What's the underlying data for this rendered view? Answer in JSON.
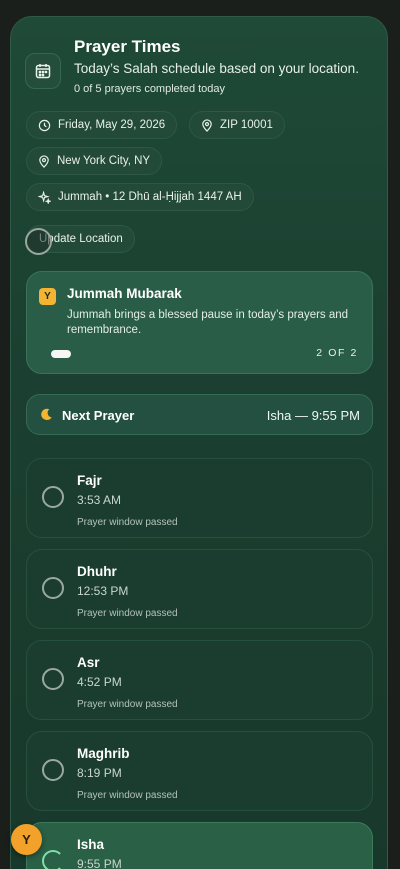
{
  "header": {
    "title": "Prayer Times",
    "subtitle": "Today’s Salah schedule based on your location.",
    "progress": "0 of 5 prayers completed today"
  },
  "chips": {
    "date": "Friday, May 29, 2026",
    "zip": "ZIP 10001",
    "city": "New York City, NY",
    "hijri": "Jummah • 12 Dhū al-Ḥijjah 1447 AH"
  },
  "update_button": "Update Location",
  "banner": {
    "badge": "Y",
    "title": "Jummah Mubarak",
    "text": "Jummah brings a blessed pause in today’s prayers and remembrance.",
    "pager": "2 OF 2"
  },
  "next_prayer": {
    "label": "Next Prayer",
    "value": "Isha — 9:55 PM"
  },
  "prayers": [
    {
      "name": "Fajr",
      "time": "3:53 AM",
      "status": "Prayer window passed"
    },
    {
      "name": "Dhuhr",
      "time": "12:53 PM",
      "status": "Prayer window passed"
    },
    {
      "name": "Asr",
      "time": "4:52 PM",
      "status": "Prayer window passed"
    },
    {
      "name": "Maghrib",
      "time": "8:19 PM",
      "status": "Prayer window passed"
    },
    {
      "name": "Isha",
      "time": "9:55 PM",
      "status": ""
    }
  ],
  "floating_badge": "Y",
  "colors": {
    "accent_yellow": "#f2b431",
    "card_green": "#1f4a37",
    "active_ring": "#7ee0a8"
  }
}
